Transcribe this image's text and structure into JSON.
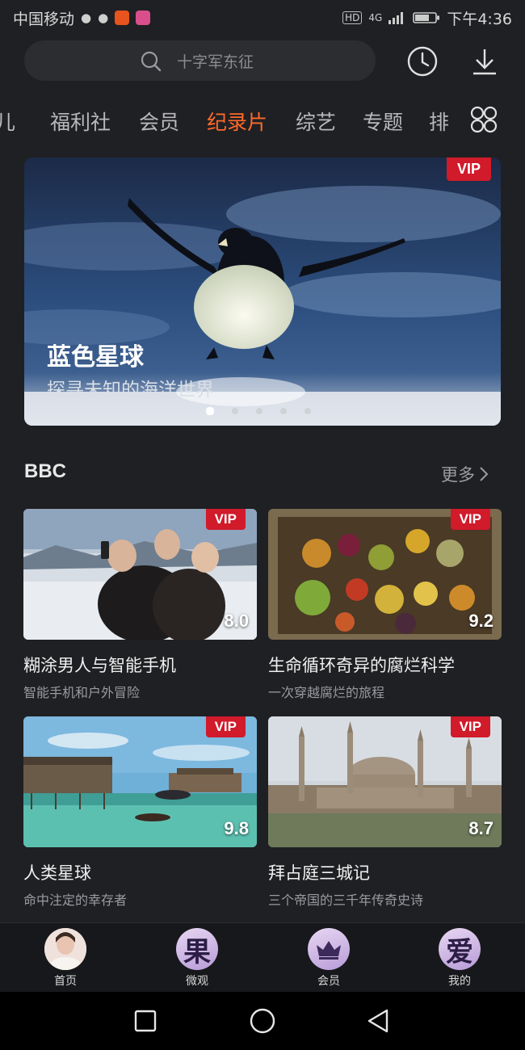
{
  "status_bar": {
    "carrier": "中国移动",
    "network": "4G",
    "time": "下午4:36",
    "hd_label": "HD"
  },
  "search": {
    "placeholder": "十字军东征"
  },
  "tabs": [
    "儿",
    "福利社",
    "会员",
    "纪录片",
    "综艺",
    "专题",
    "排"
  ],
  "active_tab": "纪录片",
  "banner": {
    "badge": "VIP",
    "title": "蓝色星球",
    "subtitle": "探寻未知的海洋世界",
    "page_count": 5,
    "active_page": 1
  },
  "section": {
    "title": "BBC",
    "more": "更多"
  },
  "cards": [
    {
      "title": "糊涂男人与智能手机",
      "desc": "智能手机和户外冒险",
      "score": "8.0",
      "badge": "VIP"
    },
    {
      "title": "生命循环奇异的腐烂科学",
      "desc": "一次穿越腐烂的旅程",
      "score": "9.2",
      "badge": "VIP"
    },
    {
      "title": "人类星球",
      "desc": "命中注定的幸存者",
      "score": "9.8",
      "badge": "VIP"
    },
    {
      "title": "拜占庭三城记",
      "desc": "三个帝国的三千年传奇史诗",
      "score": "8.7",
      "badge": "VIP"
    }
  ],
  "bottom_nav": [
    {
      "label": "首页",
      "glyph": ""
    },
    {
      "label": "微观",
      "glyph": "果"
    },
    {
      "label": "会员",
      "glyph": ""
    },
    {
      "label": "我的",
      "glyph": "爱"
    }
  ],
  "colors": {
    "accent": "#ff6a2a",
    "vip": "#d11a2a",
    "background": "#1f2023"
  }
}
